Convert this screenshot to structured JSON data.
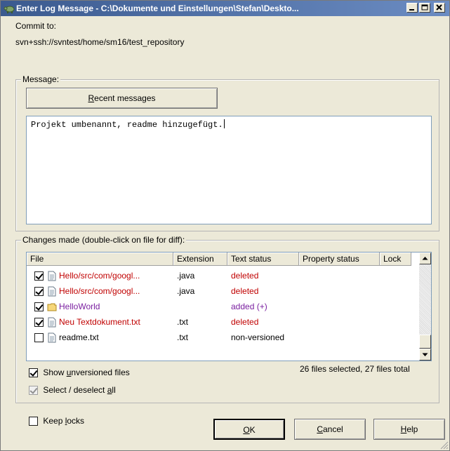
{
  "window": {
    "title": "Enter Log Message - C:\\Dokumente und Einstellungen\\Stefan\\Deskto...",
    "minimize_label": "_",
    "maximize_label": "□",
    "close_label": "×"
  },
  "commit": {
    "label": "Commit to:",
    "url": "svn+ssh://svntest/home/sm16/test_repository"
  },
  "message": {
    "group_label": "Message:",
    "recent_button_pre": "",
    "recent_button_accel": "R",
    "recent_button_post": "ecent messages",
    "text": "Projekt umbenannt, readme hinzugefügt."
  },
  "changes": {
    "group_label": "Changes made (double-click on file for diff):",
    "columns": [
      "File",
      "Extension",
      "Text status",
      "Property status",
      "Lock"
    ],
    "rows": [
      {
        "checked": true,
        "icon": "file-icon",
        "file": "Hello/src/com/googl...",
        "ext": ".java",
        "status": "deleted",
        "color": "#c00000"
      },
      {
        "checked": true,
        "icon": "file-icon",
        "file": "Hello/src/com/googl...",
        "ext": ".java",
        "status": "deleted",
        "color": "#c00000"
      },
      {
        "checked": true,
        "icon": "folder-icon",
        "file": "HelloWorld",
        "ext": "",
        "status": "added (+)",
        "color": "#7a1fa0"
      },
      {
        "checked": true,
        "icon": "file-icon",
        "file": "Neu Textdokument.txt",
        "ext": ".txt",
        "status": "deleted",
        "color": "#c00000"
      },
      {
        "checked": false,
        "icon": "file-icon",
        "file": "readme.txt",
        "ext": ".txt",
        "status": "non-versioned",
        "color": "#000000"
      }
    ],
    "show_unversioned_pre": "Show ",
    "show_unversioned_accel": "u",
    "show_unversioned_post": "nversioned files",
    "show_unversioned_checked": true,
    "select_all_pre": "Select / deselect ",
    "select_all_accel": "a",
    "select_all_post": "ll",
    "select_all_checked": true,
    "summary": "26 files selected, 27 files total"
  },
  "footer": {
    "keep_locks_pre": "Keep ",
    "keep_locks_accel": "l",
    "keep_locks_post": "ocks",
    "keep_locks_checked": false,
    "ok_accel": "O",
    "ok_post": "K",
    "cancel_accel": "C",
    "cancel_post": "ancel",
    "help_accel": "H",
    "help_post": "elp"
  }
}
